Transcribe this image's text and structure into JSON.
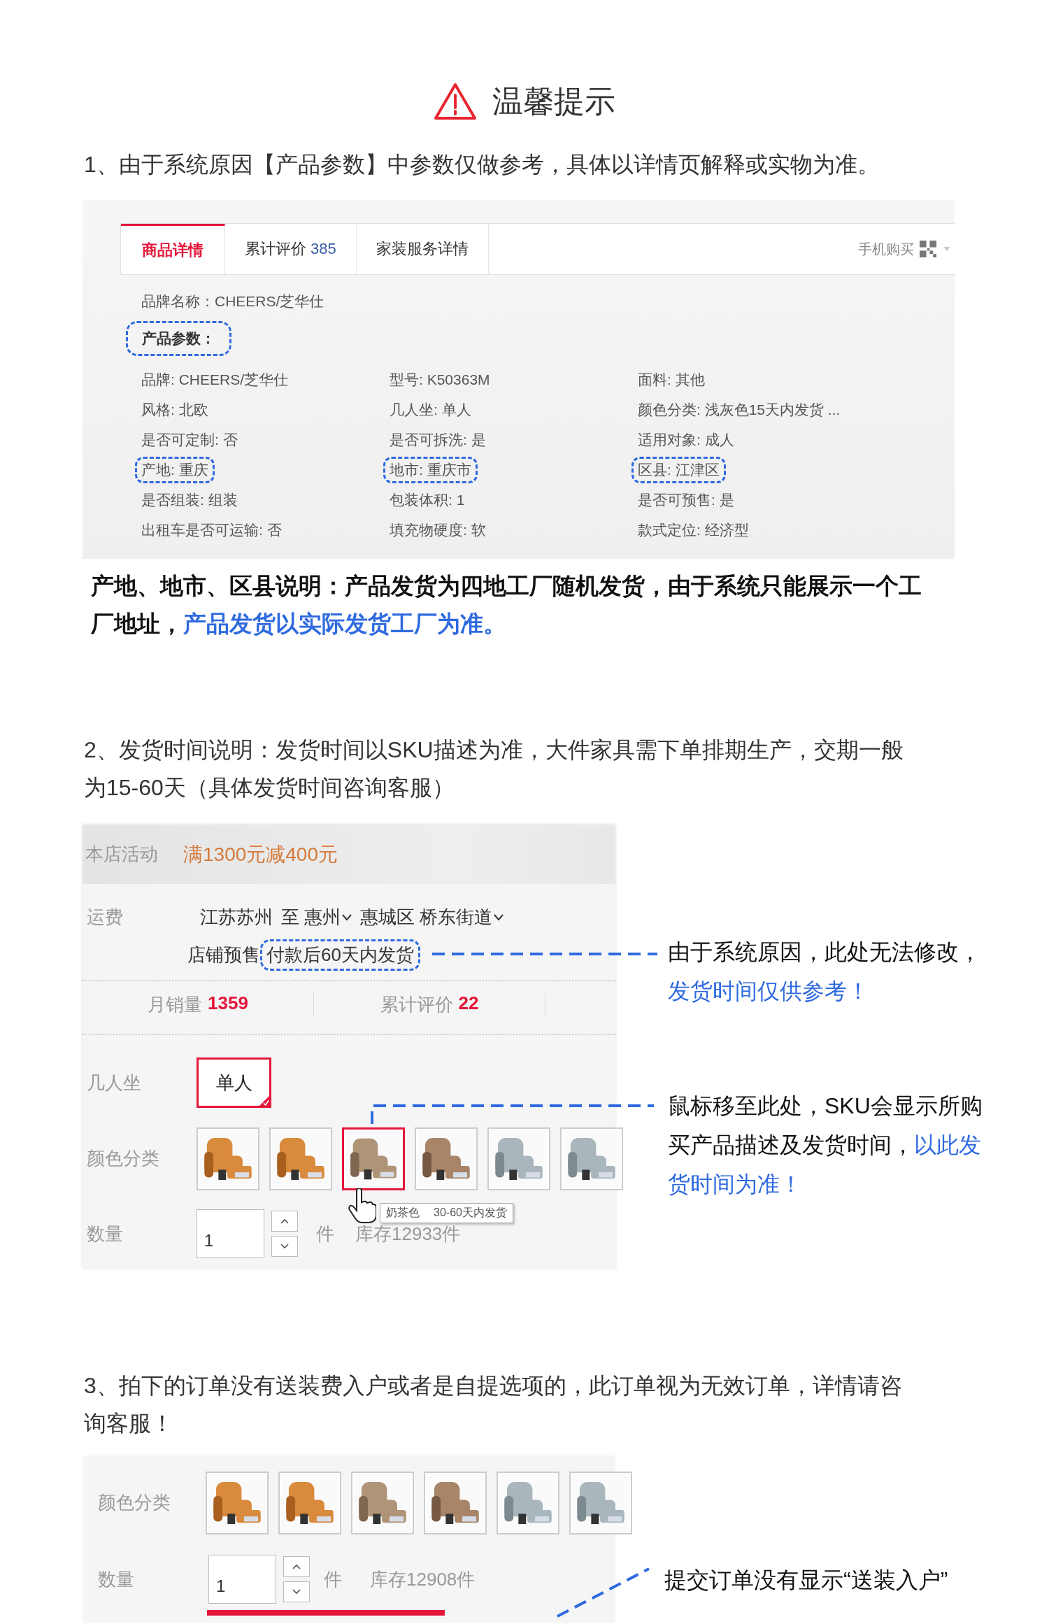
{
  "header": {
    "title": "温馨提示"
  },
  "notice_1": {
    "text": "1、由于系统原因【产品参数】中参数仅做参考，具体以详情页解释或实物为准。"
  },
  "detail_screenshot": {
    "tabs": [
      {
        "label": "商品详情",
        "selected": true
      },
      {
        "label": "累计评价",
        "count": "385",
        "selected": false
      },
      {
        "label": "家装服务详情",
        "selected": false
      }
    ],
    "mobile_buy": "手机购买",
    "brand_name": "品牌名称：CHEERS/芝华仕",
    "params_heading": "产品参数：",
    "params": [
      {
        "text": "品牌: CHEERS/芝华仕",
        "highlighted": false
      },
      {
        "text": "型号: K50363M",
        "highlighted": false
      },
      {
        "text": "面料: 其他",
        "highlighted": false
      },
      {
        "text": "风格: 北欧",
        "highlighted": false
      },
      {
        "text": "几人坐: 单人",
        "highlighted": false
      },
      {
        "text": "颜色分类: 浅灰色15天内发货 ...",
        "highlighted": false
      },
      {
        "text": "是否可定制: 否",
        "highlighted": false
      },
      {
        "text": "是否可拆洗: 是",
        "highlighted": false
      },
      {
        "text": "适用对象: 成人",
        "highlighted": false
      },
      {
        "text": "产地: 重庆",
        "highlighted": true
      },
      {
        "text": "地市: 重庆市",
        "highlighted": true
      },
      {
        "text": "区县: 江津区",
        "highlighted": true
      },
      {
        "text": "是否组装: 组装",
        "highlighted": false
      },
      {
        "text": "包装体积: 1",
        "highlighted": false
      },
      {
        "text": "是否可预售: 是",
        "highlighted": false
      },
      {
        "text": "出租车是否可运输: 否",
        "highlighted": false
      },
      {
        "text": "填充物硬度: 软",
        "highlighted": false
      },
      {
        "text": "款式定位: 经济型",
        "highlighted": false
      }
    ]
  },
  "detail_note": {
    "text": "产地、地市、区县说明：产品发货为四地工厂随机发货，由于系统只能展示一个工厂地址，",
    "highlight": "产品发货以实际发货工厂为准。"
  },
  "notice_2": {
    "text": "2、发货时间说明：发货时间以SKU描述为准，大件家具需下单排期生产，交期一般为15-60天（具体发货时间咨询客服）"
  },
  "sku_screenshot": {
    "promo": {
      "label": "本店活动",
      "value": "满1300元减400元"
    },
    "shipping": {
      "label": "运费",
      "from": "江苏苏州",
      "to": "至 惠州",
      "area": "惠城区 桥东街道",
      "presale": "店铺预售",
      "delivery": "付款后60天内发货"
    },
    "stats": [
      {
        "label": "月销量",
        "value": "1359"
      },
      {
        "label": "累计评价",
        "value": "22"
      }
    ],
    "seats": {
      "label": "几人坐",
      "options": [
        {
          "label": "单人",
          "selected": true
        }
      ]
    },
    "colors": {
      "label": "颜色分类",
      "swatches": [
        {
          "kind": "picture",
          "selected": false
        },
        {
          "kind": "picture",
          "selected": false
        },
        {
          "kind": "picture",
          "selected": true
        },
        {
          "kind": "picture",
          "selected": false
        },
        {
          "kind": "picture",
          "selected": false
        },
        {
          "kind": "picture",
          "selected": false
        }
      ]
    },
    "tooltip": {
      "name": "奶茶色",
      "time": "30-60天内发货"
    },
    "quantity": {
      "label": "数量",
      "value": "1",
      "unit": "件",
      "stock": "库存12933件"
    }
  },
  "sku_callouts": [
    {
      "text": "由于系统原因，此处无法修改，",
      "highlight": "发货时间仅供参考！"
    },
    {
      "text": "鼠标移至此处，SKU会显示所购买产品描述及发货时间，",
      "highlight": "以此发货时间为准！"
    }
  ],
  "notice_3": {
    "text": "3、拍下的订单没有送装费入户或者是自提选项的，此订单视为无效订单，详情请咨询客服！"
  },
  "order_screenshot": {
    "colors": {
      "label": "颜色分类",
      "swatches": [
        {
          "kind": "picture",
          "selected": false
        },
        {
          "kind": "picture",
          "selected": false
        },
        {
          "kind": "picture",
          "selected": false
        },
        {
          "kind": "picture",
          "selected": false
        },
        {
          "kind": "picture",
          "selected": false
        },
        {
          "kind": "picture",
          "selected": false
        }
      ]
    },
    "quantity": {
      "label": "数量",
      "value": "1",
      "unit": "件",
      "stock": "库存12908件"
    }
  },
  "order_callout": {
    "text": "提交订单没有显示“送装入户”"
  }
}
